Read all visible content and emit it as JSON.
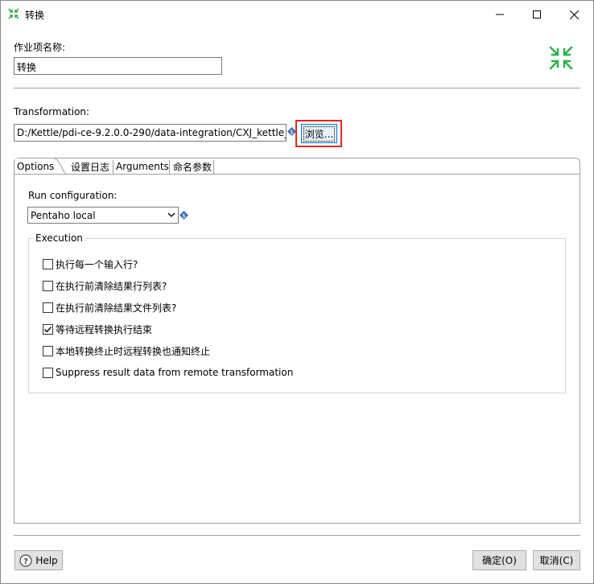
{
  "window": {
    "title": "转换"
  },
  "job_entry": {
    "name_label": "作业项名称:",
    "name_value": "转换"
  },
  "transformation": {
    "label": "Transformation:",
    "path_value": "D:/Kettle/pdi-ce-9.2.0.0-290/data-integration/CXJ_kettle_t",
    "browse_label": "浏览..."
  },
  "tabs": [
    {
      "label": "Options"
    },
    {
      "label": "设置日志"
    },
    {
      "label": "Arguments"
    },
    {
      "label": "命名参数"
    }
  ],
  "options": {
    "run_config_label": "Run configuration:",
    "run_config_value": "Pentaho local",
    "execution_group_title": "Execution",
    "checkboxes": [
      {
        "label": "执行每一个输入行?",
        "checked": false
      },
      {
        "label": "在执行前清除结果行列表?",
        "checked": false
      },
      {
        "label": "在执行前清除结果文件列表?",
        "checked": false
      },
      {
        "label": "等待远程转换执行结束",
        "checked": true
      },
      {
        "label": "本地转换终止时远程转换也通知终止",
        "checked": false
      },
      {
        "label": "Suppress result data from remote transformation",
        "checked": false
      }
    ]
  },
  "footer": {
    "help_label": "Help",
    "ok_label": "确定(O)",
    "cancel_label": "取消(C)"
  },
  "colors": {
    "accent_green": "#2db14a",
    "highlight_red": "#e0281e",
    "variable_icon_blue": "#3d6fb5"
  }
}
